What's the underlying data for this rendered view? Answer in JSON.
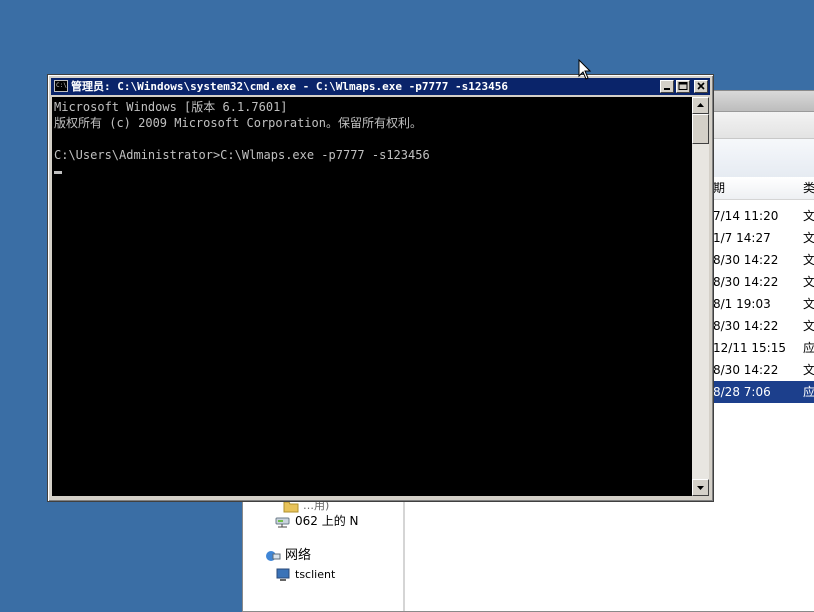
{
  "explorer": {
    "column_date_label": "期",
    "column_type_label": "类",
    "rows": [
      {
        "date": "7/14 11:20",
        "type": "文",
        "selected": false
      },
      {
        "date": "1/7 14:27",
        "type": "文",
        "selected": false
      },
      {
        "date": "8/30 14:22",
        "type": "文",
        "selected": false
      },
      {
        "date": "8/30 14:22",
        "type": "文",
        "selected": false
      },
      {
        "date": "8/1 19:03",
        "type": "文",
        "selected": false
      },
      {
        "date": "8/30 14:22",
        "type": "文",
        "selected": false
      },
      {
        "date": "12/11 15:15",
        "type": "应",
        "selected": false
      },
      {
        "date": "8/30 14:22",
        "type": "文",
        "selected": false
      },
      {
        "date": "8/28 7:06",
        "type": "应",
        "selected": true
      }
    ],
    "nav": {
      "partial_item": "…用)",
      "drive_label": "062 上的 N",
      "network_label": "网络",
      "tsclient_label": "tsclient"
    }
  },
  "cmd": {
    "title": "管理员: C:\\Windows\\system32\\cmd.exe - C:\\Wlmaps.exe  -p7777 -s123456",
    "lines": [
      "Microsoft Windows [版本 6.1.7601]",
      "版权所有 (c) 2009 Microsoft Corporation。保留所有权利。",
      "",
      "C:\\Users\\Administrator>C:\\Wlmaps.exe -p7777 -s123456"
    ],
    "colors": {
      "titlebar": "#0a246a",
      "console_bg": "#000000",
      "console_fg": "#c0c0c0",
      "desktop": "#3a6ea5",
      "selection": "#1c3f8c"
    }
  }
}
